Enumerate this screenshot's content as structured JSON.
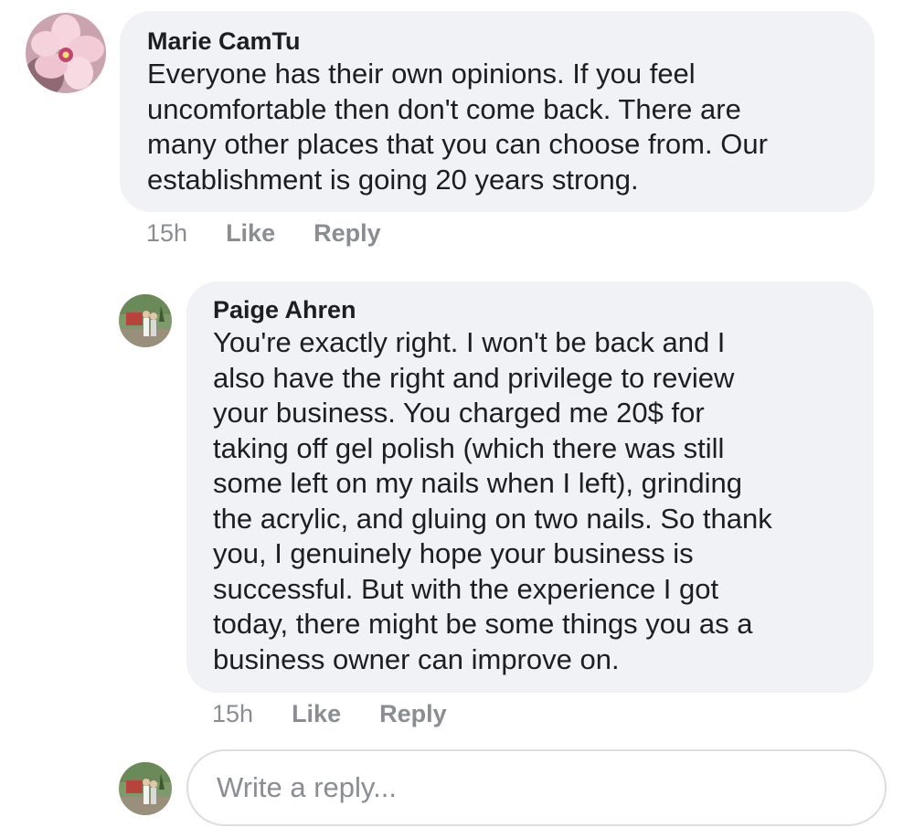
{
  "comments": [
    {
      "author": "Marie CamTu",
      "text": "Everyone has their own opinions. If you feel\nuncomfortable then don't come back. There are\nmany other places that you can choose from. Our\nestablishment is going 20 years strong.",
      "time": "15h",
      "like_label": "Like",
      "reply_label": "Reply"
    },
    {
      "author": "Paige Ahren",
      "text": "You're exactly right. I won't be back and I\nalso have the right and privilege to review\nyour business. You charged me 20$ for\ntaking off gel polish (which there was still\nsome left on my nails when I left), grinding\nthe acrylic, and gluing on two nails. So thank\nyou, I genuinely hope your business is\nsuccessful. But with the experience I got\ntoday, there might be some things you as a\nbusiness owner can improve on.",
      "time": "15h",
      "like_label": "Like",
      "reply_label": "Reply"
    }
  ],
  "reply_box": {
    "placeholder": "Write a reply..."
  },
  "colors": {
    "bubble_bg": "#f0f2f5",
    "meta_text": "#8a8d91",
    "body_text": "#1c1e21"
  }
}
